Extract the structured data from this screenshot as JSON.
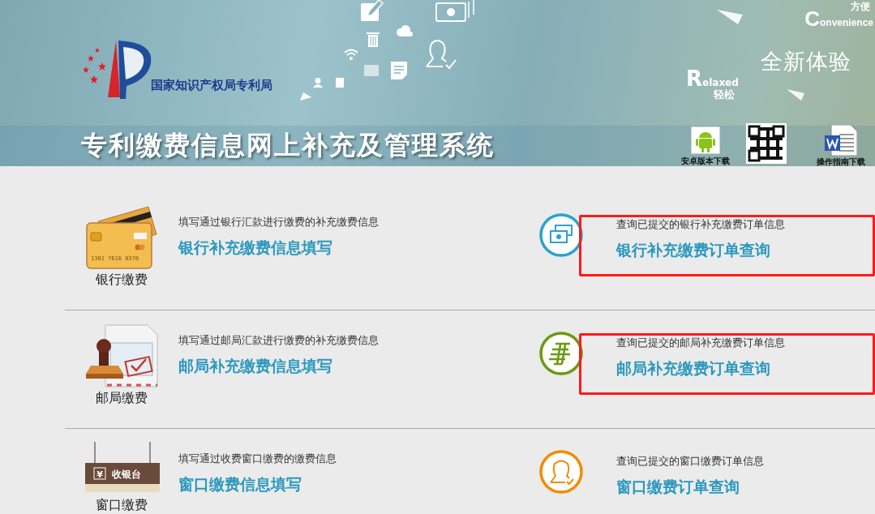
{
  "banner": {
    "agency": "国家知识产权局专利局",
    "title": "专利缴费信息网上补充及管理系统",
    "tagline": "全新体验",
    "convenience": {
      "zh": "方便",
      "en": "Convenience"
    },
    "relaxed": {
      "en": "Relaxed",
      "zh": "轻松"
    }
  },
  "downloads": [
    {
      "kind": "android",
      "label": "安卓版本下载"
    },
    {
      "kind": "qr"
    },
    {
      "kind": "word",
      "label": "操作指南下载"
    }
  ],
  "payment_methods": [
    {
      "kind": "bank",
      "label": "银行缴费",
      "card_number": "1301 7616 0370",
      "fill": {
        "hint": "填写通过银行汇款进行缴费的补充缴费信息",
        "link": "银行补充缴费信息填写"
      },
      "query": {
        "kind": "bank",
        "hint": "查询已提交的银行补充缴费订单信息",
        "link": "银行补充缴费订单查询",
        "highlighted": true
      }
    },
    {
      "kind": "post",
      "label": "邮局缴费",
      "fill": {
        "hint": "填写通过邮局汇款进行缴费的补充缴费信息",
        "link": "邮局补充缴费信息填写"
      },
      "query": {
        "kind": "post",
        "hint": "查询已提交的邮局补充缴费订单信息",
        "link": "邮局补充缴费订单查询",
        "highlighted": true
      }
    },
    {
      "kind": "window",
      "label": "窗口缴费",
      "sign_currency": "¥",
      "sign_text": "收银台",
      "fill": {
        "hint": "填写通过收费窗口缴费的缴费信息",
        "link": "窗口缴费信息填写"
      },
      "query": {
        "kind": "window",
        "hint": "查询已提交的窗口缴费订单信息",
        "link": "窗口缴费订单查询",
        "highlighted": false
      }
    }
  ]
}
